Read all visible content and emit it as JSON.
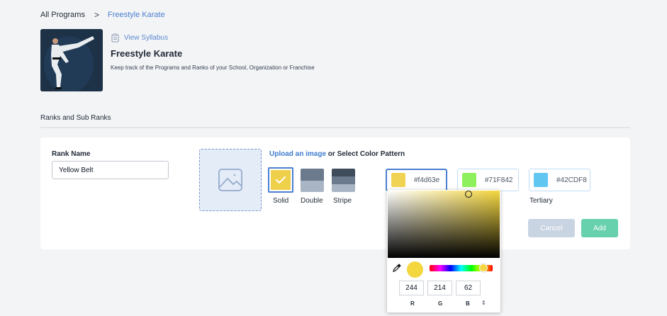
{
  "breadcrumb": {
    "root": "All Programs",
    "separator": ">",
    "current": "Freestyle Karate"
  },
  "program": {
    "view_syllabus": "View Syllabus",
    "title": "Freestyle Karate",
    "subtitle": "Keep track of the Programs and Ranks of your School, Organization or Franchise"
  },
  "section": {
    "title": "Ranks and Sub Ranks"
  },
  "rank_form": {
    "rank_name_label": "Rank Name",
    "rank_name_value": "Yellow Belt",
    "upload_link": "Upload an image",
    "upload_suffix": " or Select Color Pattern",
    "patterns": [
      {
        "label": "Solid",
        "selected": true
      },
      {
        "label": "Double",
        "selected": false
      },
      {
        "label": "Stripe",
        "selected": false
      }
    ],
    "colors": {
      "primary": {
        "label": "",
        "hex": "#f4d63e",
        "swatch": "#f4d63e"
      },
      "secondary": {
        "hex": "#71F842",
        "swatch": "#71f842"
      },
      "tertiary": {
        "label": "Tertiary",
        "hex": "#42CDF8",
        "swatch": "#42cdf8"
      }
    },
    "cancel_label": "Cancel",
    "add_label": "Add"
  },
  "color_picker": {
    "r": "244",
    "g": "214",
    "b": "62",
    "r_label": "R",
    "g_label": "G",
    "b_label": "B",
    "toggle_icon": "⇕"
  },
  "theme": {
    "accent": "#4a7fcf",
    "add_button": "#67d0ad",
    "cancel_button": "#c9d4e3"
  }
}
